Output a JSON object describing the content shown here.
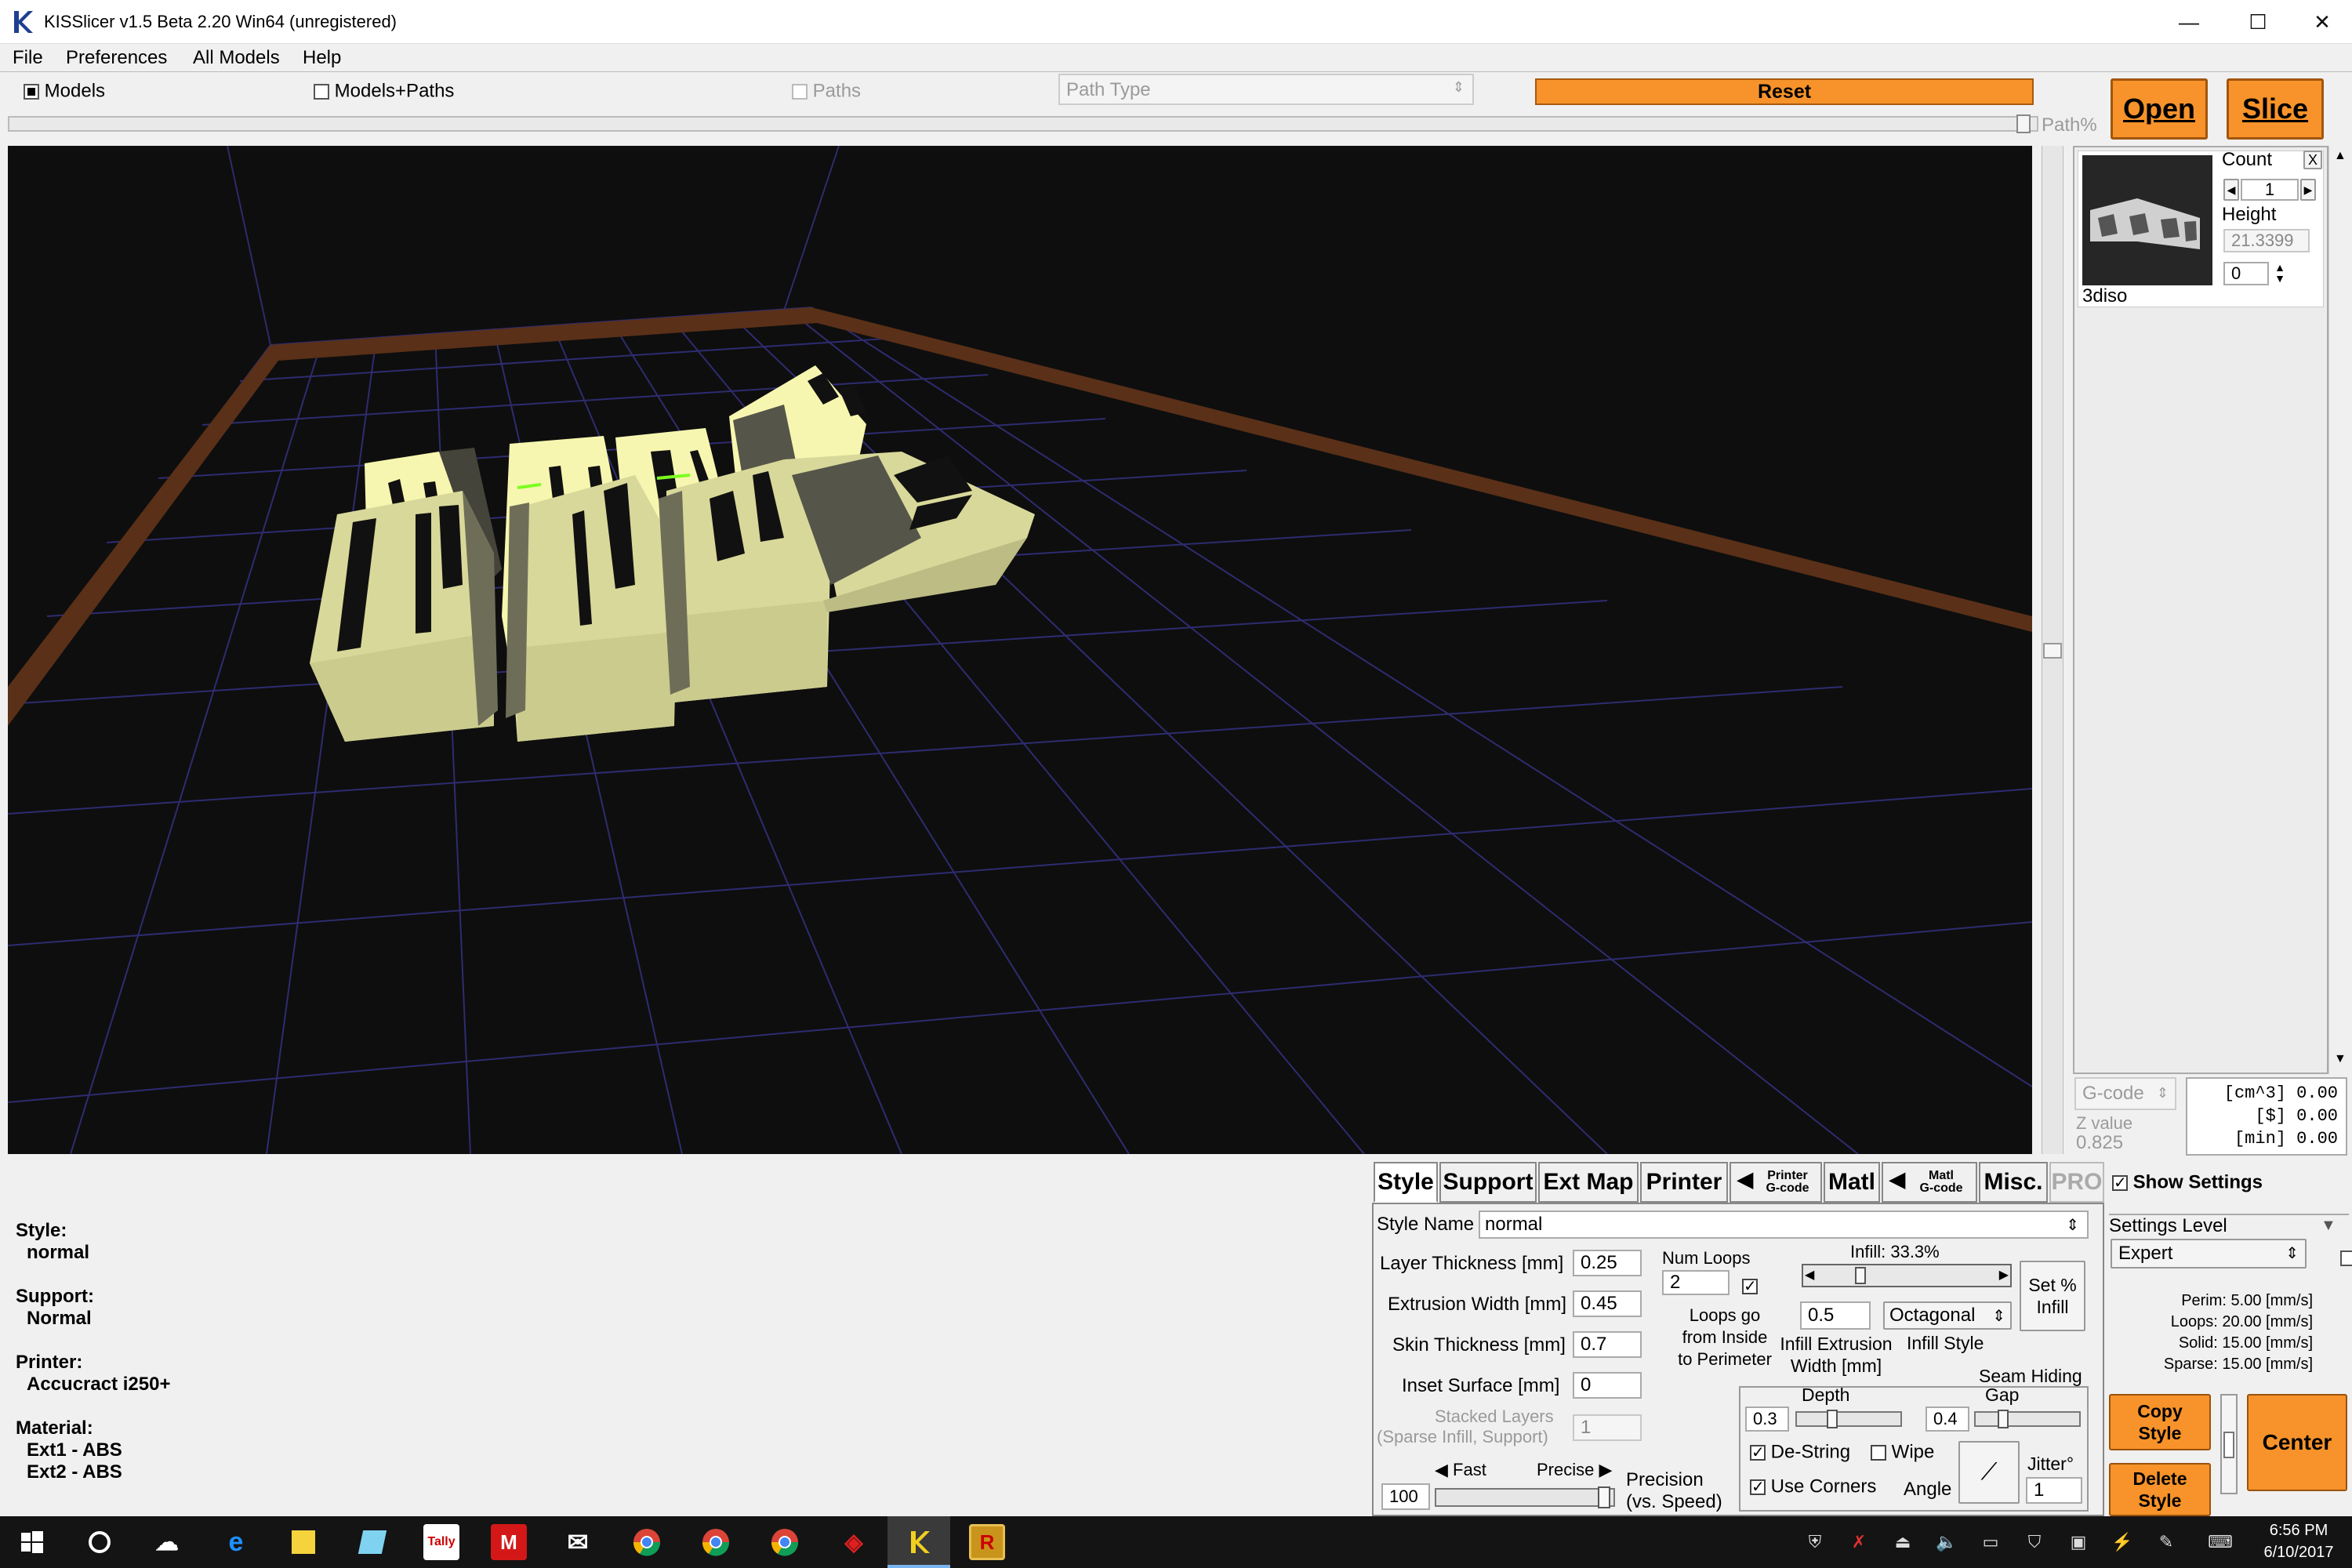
{
  "window": {
    "title": "KISSlicer v1.5 Beta 2.20 Win64 (unregistered)",
    "minimize": "—",
    "maximize": "☐",
    "close": "✕"
  },
  "menu": [
    "File",
    "Preferences",
    "All Models",
    "Help"
  ],
  "toolbar": {
    "models_label": "Models",
    "models_paths_label": "Models+Paths",
    "paths_label": "Paths",
    "path_type_value": "Path Type",
    "reset_label": "Reset",
    "open_label": "Open",
    "slice_label": "Slice",
    "path_pct_label": "Path%"
  },
  "model_panel": {
    "count_label": "Count",
    "count_value": "1",
    "height_label": "Height",
    "height_value": "21.3399",
    "rotation_value": "0",
    "close_label": "X",
    "model_name": "3diso"
  },
  "viewport_footer": {
    "gcode_label": "G-code",
    "z_value_label": "Z value",
    "z_value": "0.825",
    "stats": [
      "[cm^3] 0.00",
      "[$] 0.00",
      "[min] 0.00"
    ]
  },
  "summary": [
    {
      "label": "Style:",
      "value": "normal"
    },
    {
      "label": "Support:",
      "value": "Normal"
    },
    {
      "label": "Printer:",
      "value": "Accucract i250+"
    },
    {
      "label": "Material:",
      "value": "Ext1 - ABS",
      "value2": "Ext2 - ABS"
    }
  ],
  "tabs": {
    "style": "Style",
    "support": "Support",
    "ext_map": "Ext Map",
    "printer": "Printer",
    "printer_gcode_1": "Printer",
    "printer_gcode_2": "G-code",
    "matl": "Matl",
    "matl_gcode_1": "Matl",
    "matl_gcode_2": "G-code",
    "misc": "Misc.",
    "pro": "PRO"
  },
  "style_settings": {
    "style_name_label": "Style Name",
    "style_name_value": "normal",
    "layer_thickness_label": "Layer Thickness [mm]",
    "layer_thickness_value": "0.25",
    "extrusion_width_label": "Extrusion Width [mm]",
    "extrusion_width_value": "0.45",
    "skin_thickness_label": "Skin Thickness [mm]",
    "skin_thickness_value": "0.7",
    "inset_surface_label": "Inset  Surface [mm]",
    "inset_surface_value": "0",
    "stacked_layers_label": "Stacked Layers",
    "stacked_layers_sub": "(Sparse Infill, Support)",
    "stacked_layers_value": "1",
    "num_loops_label": "Num Loops",
    "num_loops_value": "2",
    "loops_note_1": "Loops go",
    "loops_note_2": "from Inside",
    "loops_note_3": "to Perimeter",
    "infill_label": "Infill: 33.3%",
    "infill_fraction": 0.333,
    "infill_width_value": "0.5",
    "infill_style_value": "Octagonal",
    "infill_ext_label_1": "Infill Extrusion",
    "infill_ext_label_2": "Width [mm]",
    "infill_style_label": "Infill Style",
    "set_infill_1": "Set %",
    "set_infill_2": "Infill",
    "seam_hiding_label": "Seam Hiding",
    "depth_label": "Depth",
    "depth_value": "0.3",
    "gap_label": "Gap",
    "gap_value": "0.4",
    "destring_label": "De-String",
    "wipe_label": "Wipe",
    "use_corners_label": "Use Corners",
    "angle_label": "Angle",
    "jitter_label": "Jitter°",
    "jitter_value": "1",
    "fast_label": "Fast",
    "precise_label": "Precise",
    "precision_value": "100",
    "precision_label_1": "Precision",
    "precision_label_2": "(vs. Speed)"
  },
  "right_settings": {
    "show_settings_label": "Show Settings",
    "settings_level_label": "Settings Level",
    "settings_level_value": "Expert",
    "speeds": [
      "Perim:  5.00 [mm/s]",
      "Loops:  20.00 [mm/s]",
      "Solid:  15.00 [mm/s]",
      "Sparse: 15.00 [mm/s]"
    ],
    "copy_style_1": "Copy",
    "copy_style_2": "Style",
    "delete_style_1": "Delete",
    "delete_style_2": "Style",
    "center_label": "Center"
  },
  "taskbar": {
    "time": "6:56 PM",
    "date": "6/10/2017",
    "icons": [
      "windows-start-icon",
      "cortana-icon",
      "onedrive-icon",
      "edge-icon",
      "sticky-notes-icon",
      "app-icon",
      "tally-icon",
      "m-app-icon",
      "mail-icon",
      "chrome-icon",
      "chrome-icon",
      "chrome-icon",
      "sketchup-icon",
      "kisslicer-icon",
      "r-app-icon"
    ]
  },
  "colors": {
    "accent_orange": "#f7932a",
    "model_color": "#e8e8a8",
    "bed_border": "#5a3018",
    "grid": "#2e2c70"
  }
}
